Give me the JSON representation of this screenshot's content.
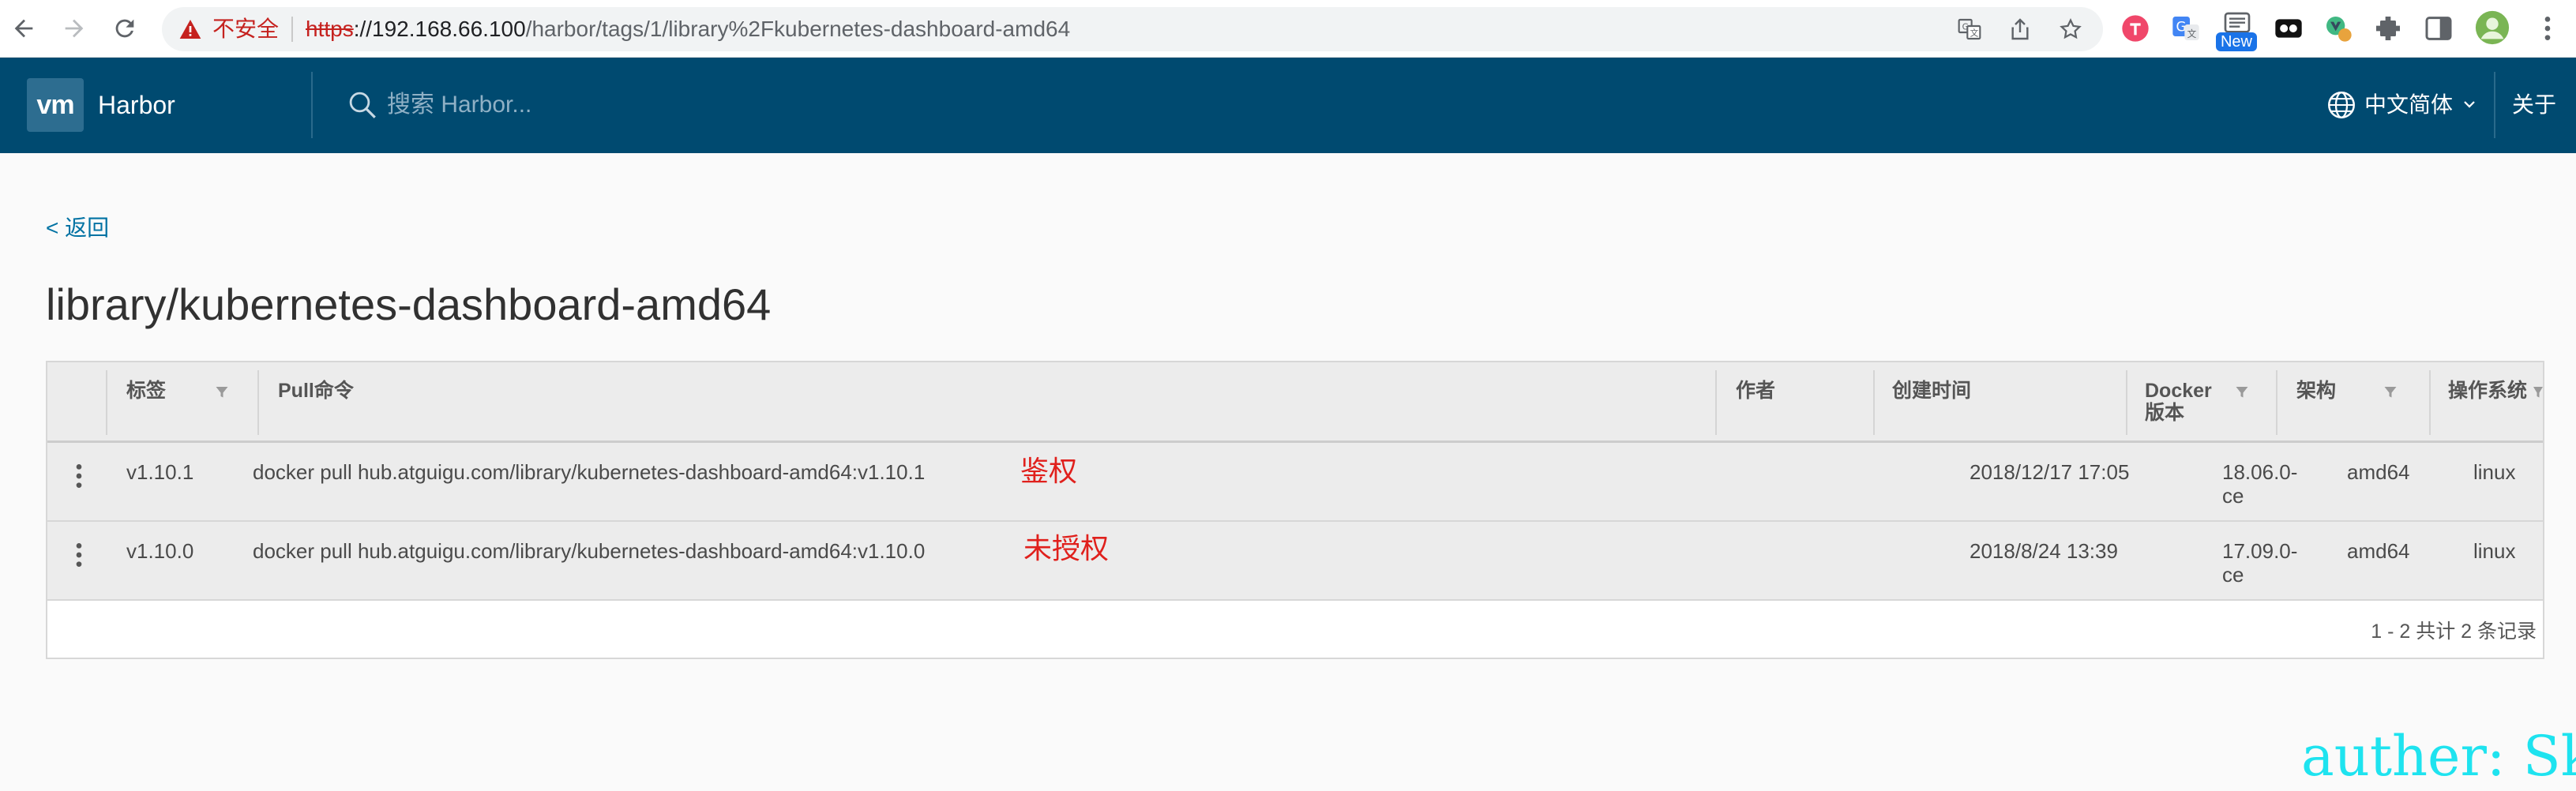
{
  "browser": {
    "insecure_label": "不安全",
    "url_scheme": "https",
    "url_host": "://192.168.66.100",
    "url_path": "/harbor/tags/1/library%2Fkubernetes-dashboard-amd64",
    "new_badge": "New"
  },
  "header": {
    "logo_text": "vm",
    "brand": "Harbor",
    "search_placeholder": "搜索 Harbor...",
    "language": "中文简体",
    "about": "关于",
    "color": "#004a70"
  },
  "page": {
    "back_label": "< 返回",
    "title": "library/kubernetes-dashboard-amd64"
  },
  "table": {
    "columns": {
      "tag": "标签",
      "pull": "Pull命令",
      "author": "作者",
      "created": "创建时间",
      "docker_line1": "Docker",
      "docker_line2": "版本",
      "arch": "架构",
      "os": "操作系统"
    },
    "rows": [
      {
        "tag": "v1.10.1",
        "pull": "docker pull hub.atguigu.com/library/kubernetes-dashboard-amd64:v1.10.1",
        "annotation": "鉴权",
        "author": "",
        "created": "2018/12/17 17:05",
        "docker_line1": "18.06.0-",
        "docker_line2": "ce",
        "arch": "amd64",
        "os": "linux"
      },
      {
        "tag": "v1.10.0",
        "pull": "docker pull hub.atguigu.com/library/kubernetes-dashboard-amd64:v1.10.0",
        "annotation": "未授权",
        "author": "",
        "created": "2018/8/24 13:39",
        "docker_line1": "17.09.0-",
        "docker_line2": "ce",
        "arch": "amd64",
        "os": "linux"
      }
    ],
    "footer": "1 - 2 共计 2 条记录"
  },
  "watermark": "auther: Ske",
  "icons": [
    "back-arrow-icon",
    "forward-arrow-icon",
    "reload-icon",
    "warning-icon",
    "translate-icon",
    "share-icon",
    "star-icon",
    "extension-icon",
    "profile-avatar",
    "menu-dots-icon",
    "search-icon",
    "globe-icon",
    "chevron-down-icon",
    "filter-icon",
    "row-actions-icon"
  ]
}
